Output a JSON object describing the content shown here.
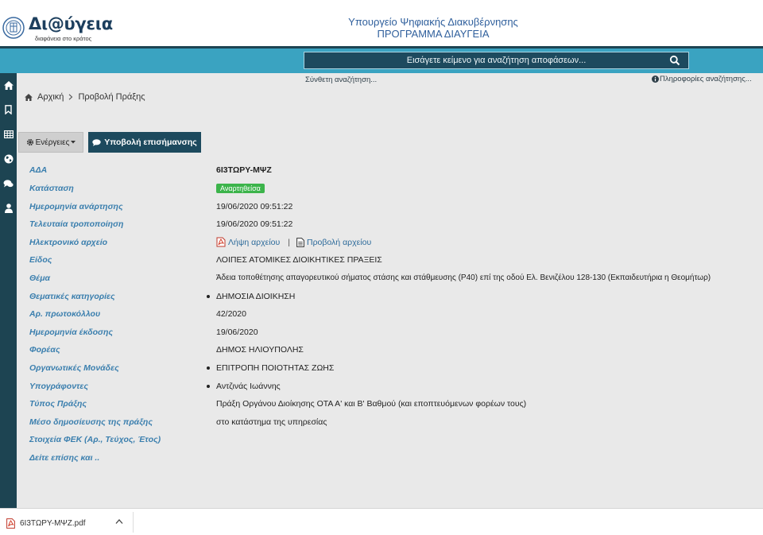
{
  "header": {
    "logo_text": "Δι@ύγεια",
    "logo_subtitle": "διαφάνεια στο κράτος",
    "ministry_line1": "Υπουργείο Ψηφιακής Διακυβέρνησης",
    "ministry_line2": "ΠΡΟΓΡΑΜΜΑ ΔΙΑΥΓΕΙΑ"
  },
  "search": {
    "placeholder": "Εισάγετε κείμενο για αναζήτηση αποφάσεων...",
    "advanced_link": "Σύνθετη αναζήτηση...",
    "info_link": "Πληροφορίες αναζήτησης..."
  },
  "sidebar": {
    "icons": [
      "home-icon",
      "bookmark-icon",
      "table-icon",
      "globe-icon",
      "comments-icon",
      "user-icon"
    ]
  },
  "breadcrumb": {
    "home": "Αρχική",
    "current": "Προβολή Πράξης"
  },
  "actions": {
    "actions_label": "Ενέργειες",
    "submit_label": "Υποβολή επισήμανσης"
  },
  "details": {
    "ada_label": "ΑΔΑ",
    "ada_value": "6Ι3ΤΩΡΥ-ΜΨΖ",
    "status_label": "Κατάσταση",
    "status_value": "Αναρτηθείσα",
    "published_label": "Ημερομηνία ανάρτησης",
    "published_value": "19/06/2020 09:51:22",
    "modified_label": "Τελευταία τροποποίηση",
    "modified_value": "19/06/2020 09:51:22",
    "file_label": "Ηλεκτρονικό αρχείο",
    "file_download": "Λήψη αρχείου",
    "file_view": "Προβολή αρχείου",
    "type_label": "Είδος",
    "type_value": "ΛΟΙΠΕΣ ΑΤΟΜΙΚΕΣ ΔΙΟΙΚΗΤΙΚΕΣ ΠΡΑΞΕΙΣ",
    "subject_label": "Θέμα",
    "subject_value": "Άδεια τοποθέτησης απαγορευτικού σήματος στάσης και στάθμευσης (Ρ40) επί της οδού Ελ. Βενιζέλου 128-130 (Εκπαιδευτήρια η Θεομήτωρ)",
    "categories_label": "Θεματικές κατηγορίες",
    "categories_value": "ΔΗΜΟΣΙΑ ΔΙΟΙΚΗΣΗ",
    "protocol_label": "Αρ. πρωτοκόλλου",
    "protocol_value": "42/2020",
    "issue_date_label": "Ημερομηνία έκδοσης",
    "issue_date_value": "19/06/2020",
    "agency_label": "Φορέας",
    "agency_value": "ΔΗΜΟΣ ΗΛΙΟΥΠΟΛΗΣ",
    "units_label": "Οργανωτικές Μονάδες",
    "units_value": "ΕΠΙΤΡΟΠΗ ΠΟΙΟΤΗΤΑΣ ΖΩΗΣ",
    "signers_label": "Υπογράφοντες",
    "signers_value": "Αντζινάς Ιωάννης",
    "act_type_label": "Τύπος Πράξης",
    "act_type_value": "Πράξη Οργάνου Διοίκησης ΟΤΑ Α' και Β' Βαθμού (και εποπτευόμενων φορέων τους)",
    "publication_label": "Μέσο δημοσίευσης της πράξης",
    "publication_value": "στο κατάστημα της υπηρεσίας",
    "fek_label": "Στοιχεία ΦΕΚ (Αρ., Τεύχος, Έτος)",
    "see_also_label": "Δείτε επίσης και .."
  },
  "download_bar": {
    "filename": "6Ι3ΤΩΡΥ-ΜΨΖ.pdf"
  },
  "colors": {
    "teal": "#3aa3c1",
    "navy": "#1d4a5e",
    "label_blue": "#3b7fae",
    "status_green": "#3cb44b"
  }
}
